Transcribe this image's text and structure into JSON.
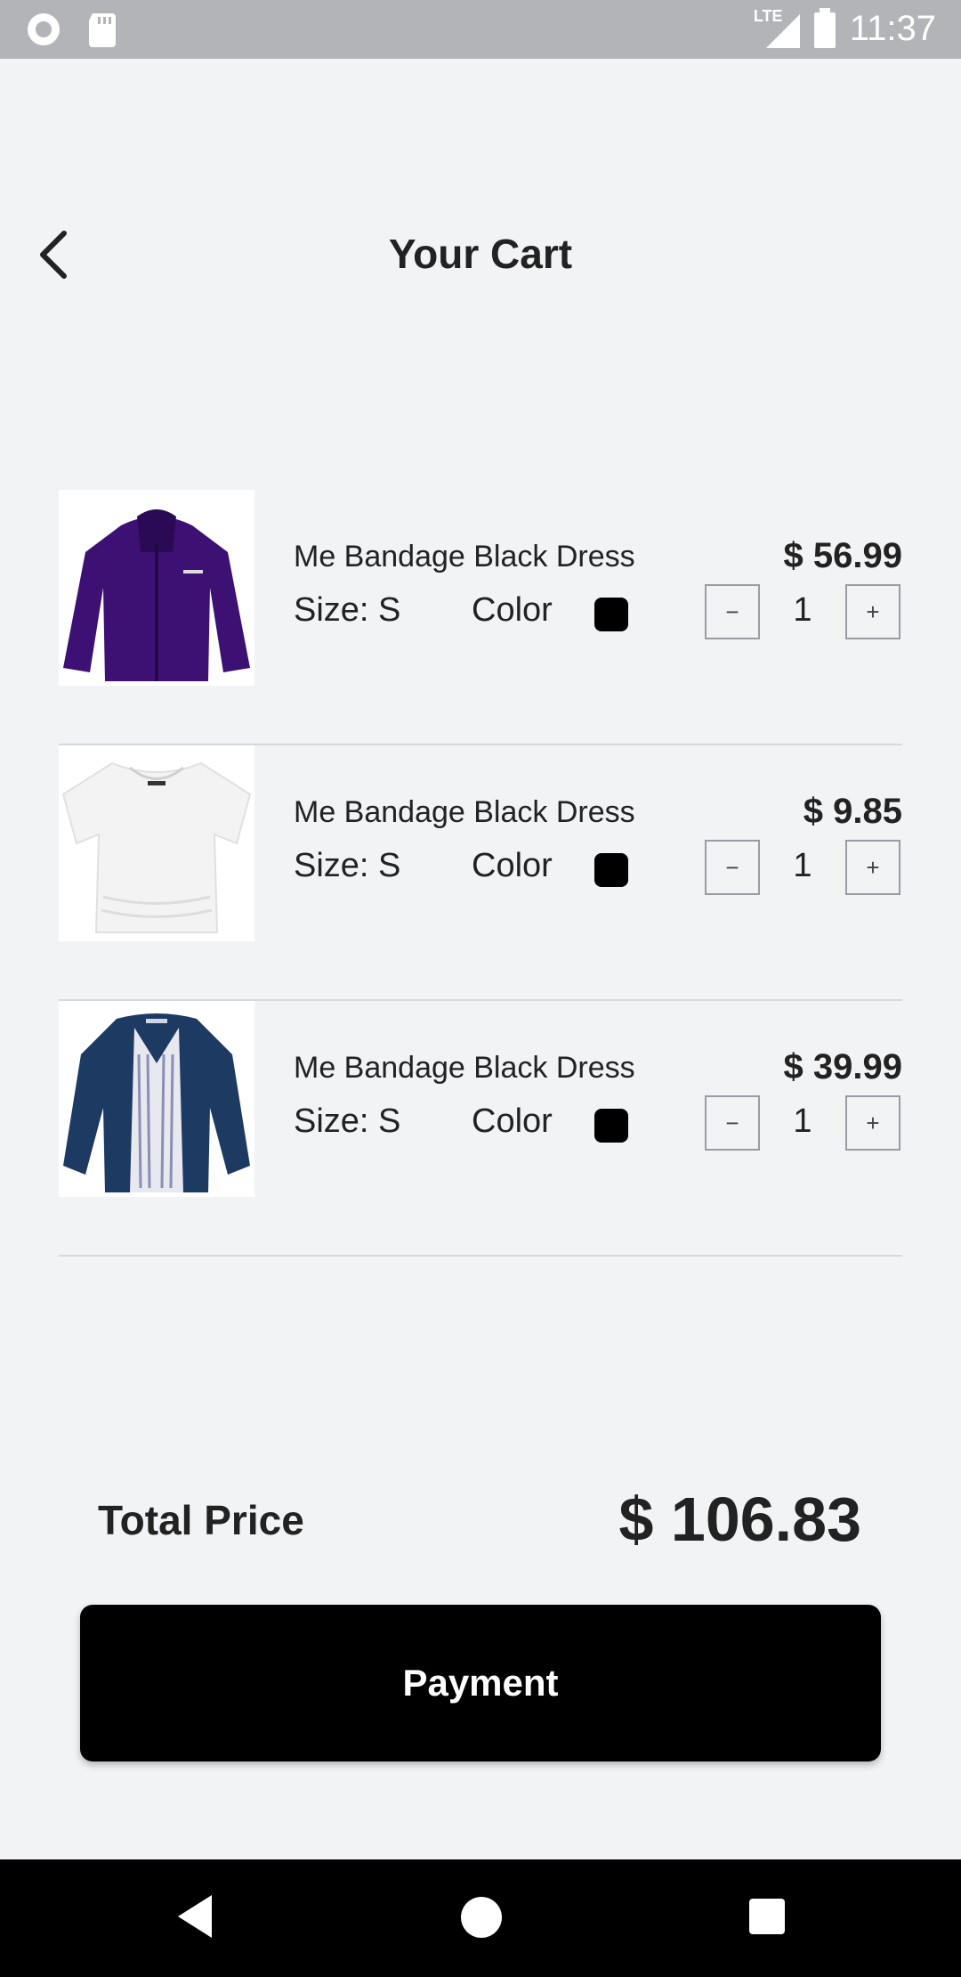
{
  "status_bar": {
    "time": "11:37",
    "network_label": "LTE",
    "icons": [
      "record-icon",
      "sd-card-icon",
      "lte-signal-icon",
      "battery-icon"
    ]
  },
  "header": {
    "title": "Your Cart",
    "back_icon": "chevron-left-icon"
  },
  "cart": {
    "items": [
      {
        "image": "purple-jacket",
        "name": "Me Bandage Black Dress",
        "size": "Size: S",
        "color_label": "Color",
        "color": "#000000",
        "price": "$ 56.99",
        "minus_label": "−",
        "quantity": "1",
        "plus_label": "+"
      },
      {
        "image": "white-tshirt",
        "name": "Me Bandage Black Dress",
        "size": "Size: S",
        "color_label": "Color",
        "color": "#000000",
        "price": "$ 9.85",
        "minus_label": "−",
        "quantity": "1",
        "plus_label": "+"
      },
      {
        "image": "navy-jacket",
        "name": "Me Bandage Black Dress",
        "size": "Size: S",
        "color_label": "Color",
        "color": "#000000",
        "price": "$ 39.99",
        "minus_label": "−",
        "quantity": "1",
        "plus_label": "+"
      }
    ]
  },
  "summary": {
    "total_label": "Total Price",
    "total_value": "$ 106.83"
  },
  "actions": {
    "payment_label": "Payment"
  },
  "colors": {
    "background": "#f2f3f5",
    "accent": "#000000",
    "status_bar": "#b3b4b7"
  }
}
